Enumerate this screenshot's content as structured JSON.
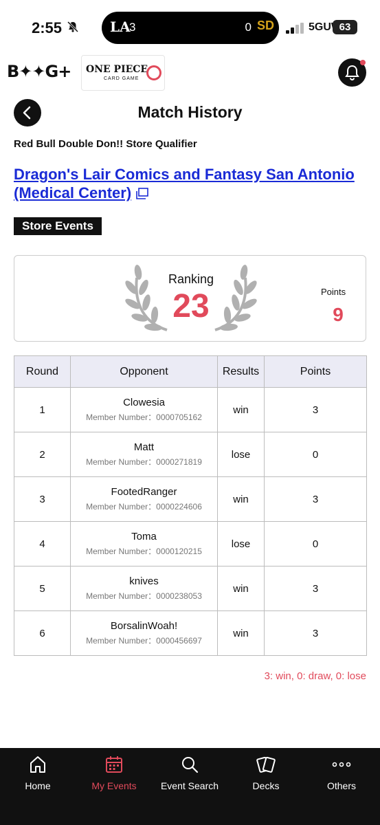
{
  "status_bar": {
    "time": "2:55",
    "live_activity": {
      "team_a": "LA",
      "score_a": "3",
      "score_b": "0",
      "team_b": "SD"
    },
    "network": "5GUW",
    "battery": "63"
  },
  "header": {
    "brand": "B✦✦G+",
    "game_logo_title": "ONE PIECE",
    "game_logo_subtitle": "CARD GAME"
  },
  "page": {
    "title": "Match History",
    "event_name": "Red Bull Double Don!! Store Qualifier",
    "store_name": "Dragon's Lair Comics and Fantasy San Antonio (Medical Center)",
    "store_tag": "Store Events"
  },
  "ranking": {
    "label": "Ranking",
    "value": "23",
    "points_label": "Points",
    "points_value": "9"
  },
  "table": {
    "headers": [
      "Round",
      "Opponent",
      "Results",
      "Points"
    ],
    "member_prefix": "Member Number：",
    "rows": [
      {
        "round": "1",
        "opponent": "Clowesia",
        "member_number": "0000705162",
        "result": "win",
        "points": "3"
      },
      {
        "round": "2",
        "opponent": "Matt",
        "member_number": "0000271819",
        "result": "lose",
        "points": "0"
      },
      {
        "round": "3",
        "opponent": "FootedRanger",
        "member_number": "0000224606",
        "result": "win",
        "points": "3"
      },
      {
        "round": "4",
        "opponent": "Toma",
        "member_number": "0000120215",
        "result": "lose",
        "points": "0"
      },
      {
        "round": "5",
        "opponent": "knives",
        "member_number": "0000238053",
        "result": "win",
        "points": "3"
      },
      {
        "round": "6",
        "opponent": "BorsalinWoah!",
        "member_number": "0000456697",
        "result": "win",
        "points": "3"
      }
    ]
  },
  "legend": "3: win, 0: draw, 0: lose",
  "tabs": [
    {
      "label": "Home",
      "icon": "home-icon",
      "active": false
    },
    {
      "label": "My Events",
      "icon": "calendar-icon",
      "active": true
    },
    {
      "label": "Event Search",
      "icon": "search-icon",
      "active": false
    },
    {
      "label": "Decks",
      "icon": "cards-icon",
      "active": false
    },
    {
      "label": "Others",
      "icon": "more-icon",
      "active": false
    }
  ],
  "colors": {
    "accent": "#e14a5b",
    "link": "#1a2bd6",
    "dark": "#111111",
    "table_header": "#ebebf5"
  }
}
